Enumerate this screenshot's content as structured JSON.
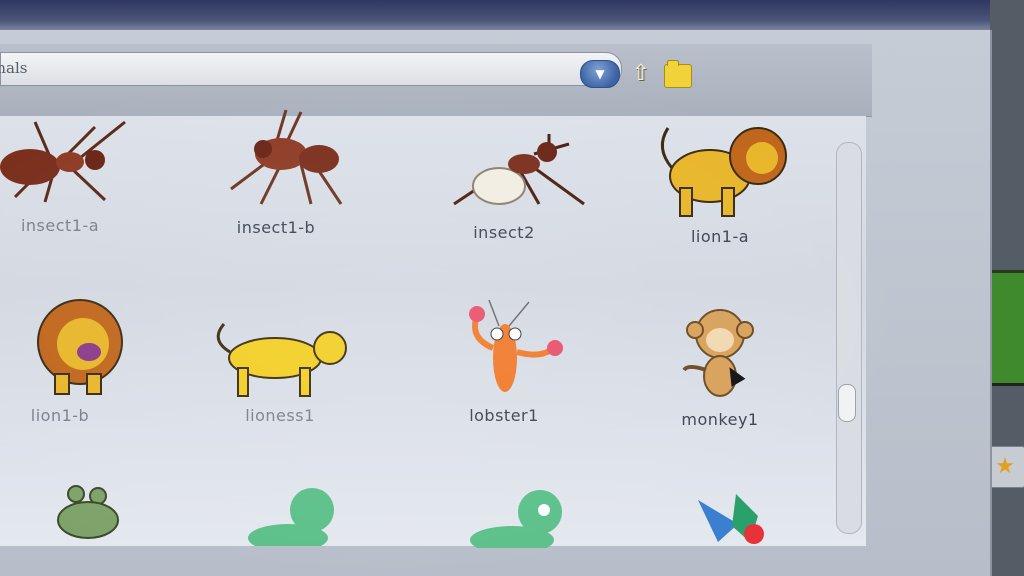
{
  "library": {
    "folder": "imals",
    "icons": {
      "dropdown": "chevron-down-icon",
      "up": "folder-up-icon",
      "new_folder": "new-folder-icon"
    }
  },
  "sprites": [
    {
      "name": "insect1-a"
    },
    {
      "name": "insect1-b"
    },
    {
      "name": "insect2"
    },
    {
      "name": "lion1-a"
    },
    {
      "name": "lion1-b"
    },
    {
      "name": "lioness1"
    },
    {
      "name": "lobster1"
    },
    {
      "name": "monkey1"
    }
  ],
  "colors": {
    "ant": "#7a2e1c",
    "lion": "#e8b62a",
    "mane": "#c0661c",
    "lobster": "#f07a2a",
    "monkey": "#d7a15a",
    "dino": "#5cc08a",
    "select_blue": "#3d63a4"
  }
}
